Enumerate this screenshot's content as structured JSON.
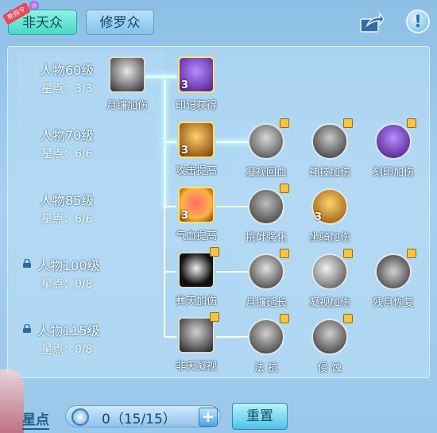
{
  "tabs": {
    "active": "非天众",
    "inactive": "修罗众",
    "active_badge": "新指令"
  },
  "levels": [
    {
      "title": "人物60级",
      "stars": "星点：3/3",
      "locked": false
    },
    {
      "title": "人物70级",
      "stars": "星点：6/6",
      "locked": false
    },
    {
      "title": "人物85级",
      "stars": "星点：6/6",
      "locked": false
    },
    {
      "title": "人物100级",
      "stars": "星点：0/8",
      "locked": true
    },
    {
      "title": "人物115级",
      "stars": "星点：0/8",
      "locked": true
    }
  ],
  "skills": {
    "row1_main": {
      "label": "月镰加伤",
      "level": ""
    },
    "row1_branch": {
      "label": "印记获得",
      "level": "3"
    },
    "row2_main": {
      "label": "攻击提高",
      "level": "3"
    },
    "row2_b1": {
      "label": "凝视回血"
    },
    "row2_b2": {
      "label": "神技加伤"
    },
    "row2_b3": {
      "label": "刻印加伤"
    },
    "row3_main": {
      "label": "气血提高",
      "level": "3"
    },
    "row3_b1": {
      "label": "挑衅强化"
    },
    "row3_b2": {
      "label": "坐骑加伤",
      "level": "3"
    },
    "row4_main": {
      "label": "彝天加伤"
    },
    "row4_b1": {
      "label": "月镰延长"
    },
    "row4_b2": {
      "label": "凝视加伤"
    },
    "row4_b3": {
      "label": "残月恢复"
    },
    "row5_main": {
      "label": "非天凝视"
    },
    "row5_b1": {
      "label": "法 抗"
    },
    "row5_b2": {
      "label": "侵 蚀"
    }
  },
  "footer": {
    "label": "星点",
    "value": "0（15/15）",
    "plus": "+",
    "reset": "重置"
  },
  "colors": {
    "accent": "#47d8c6",
    "panel": "#bfe0f8",
    "text": "#ffffff"
  }
}
